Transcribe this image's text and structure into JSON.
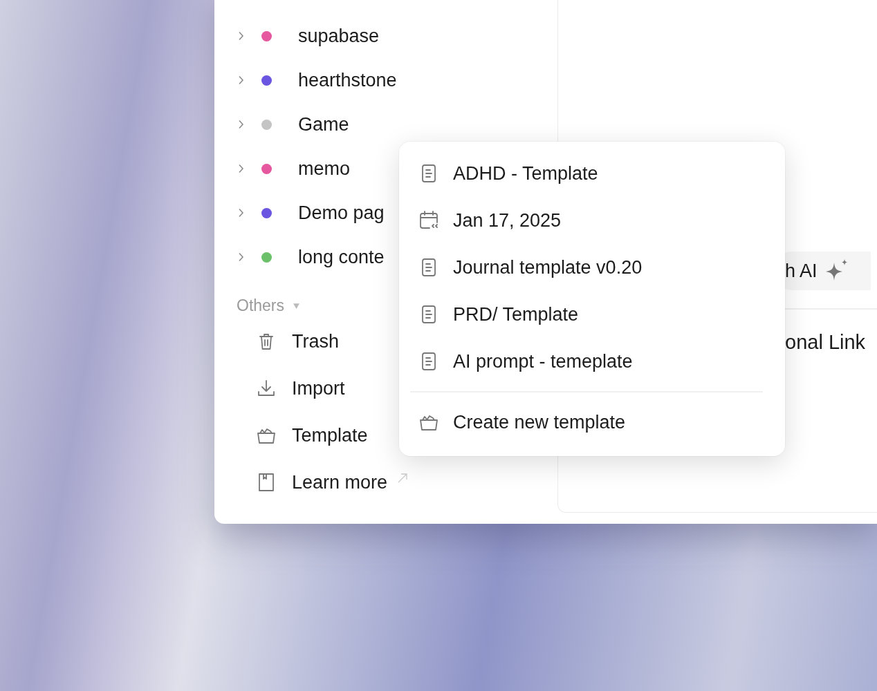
{
  "sidebar": {
    "spaces": [
      {
        "label": "supabase",
        "color": "#e5579e",
        "expanded": false
      },
      {
        "label": "hearthstone",
        "color": "#6a55e0",
        "expanded": false
      },
      {
        "label": "Game",
        "color": "#c4c4c4",
        "expanded": false
      },
      {
        "label": "memo",
        "color": "#e5579e",
        "expanded": false
      },
      {
        "label": "Demo pag",
        "color": "#6a55e0",
        "expanded": false
      },
      {
        "label": "long conte",
        "color": "#6cc06a",
        "expanded": false
      }
    ],
    "others": {
      "title": "Others",
      "expanded": true,
      "items": [
        {
          "kind": "trash",
          "label": "Trash"
        },
        {
          "kind": "import",
          "label": "Import"
        },
        {
          "kind": "template",
          "label": "Template"
        },
        {
          "kind": "link",
          "label": "Learn more"
        }
      ]
    }
  },
  "main": {
    "ai_button": {
      "label": "h AI"
    },
    "section_title": "onal Link"
  },
  "template_menu": {
    "items": [
      {
        "kind": "page",
        "label": "ADHD - Template"
      },
      {
        "kind": "date",
        "label": "Jan 17, 2025"
      },
      {
        "kind": "page",
        "label": "Journal template v0.20"
      },
      {
        "kind": "page",
        "label": "PRD/ Template"
      },
      {
        "kind": "page",
        "label": "AI prompt - temeplate"
      }
    ],
    "footer": {
      "label": "Create new template"
    }
  }
}
